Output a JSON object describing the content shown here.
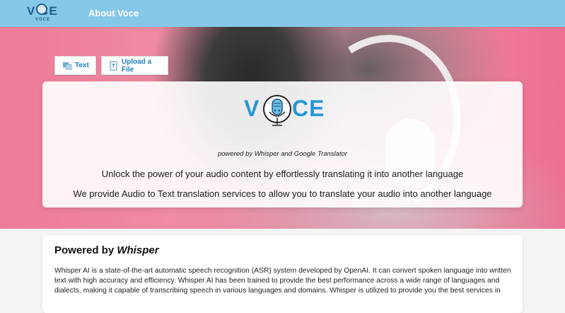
{
  "header": {
    "logo_text": "V CE",
    "logo_sub": "VOCE",
    "nav_about": "About Voce"
  },
  "tabs": [
    {
      "label": "Text",
      "icon": "text-translate-icon"
    },
    {
      "label": "Upload a File",
      "icon": "upload-file-icon"
    }
  ],
  "hero": {
    "logo_left": "V",
    "logo_right": "CE",
    "powered": "powered by Whisper and Google Translator",
    "tagline1": "Unlock the power of your audio content by effortlessly translating it into another language",
    "tagline2": "We provide Audio to Text translation services to allow you to translate your audio into another language"
  },
  "whisper": {
    "title_prefix": "Powered by ",
    "title_emph": "Whisper",
    "body": "Whisper AI is a state-of-the-art automatic speech recognition (ASR) system developed by OpenAI. It can convert spoken language into written text with high accuracy and efficiency. Whisper AI has been trained to provide the best performance across a wide range of languages and dialects, making it capable of transcribing speech in various languages and domains. Whisper is utilized to provide you the best services in"
  },
  "colors": {
    "header_bg": "#86c8e8",
    "brand_blue": "#2597d4",
    "hero_pink": "#ee7b98"
  }
}
